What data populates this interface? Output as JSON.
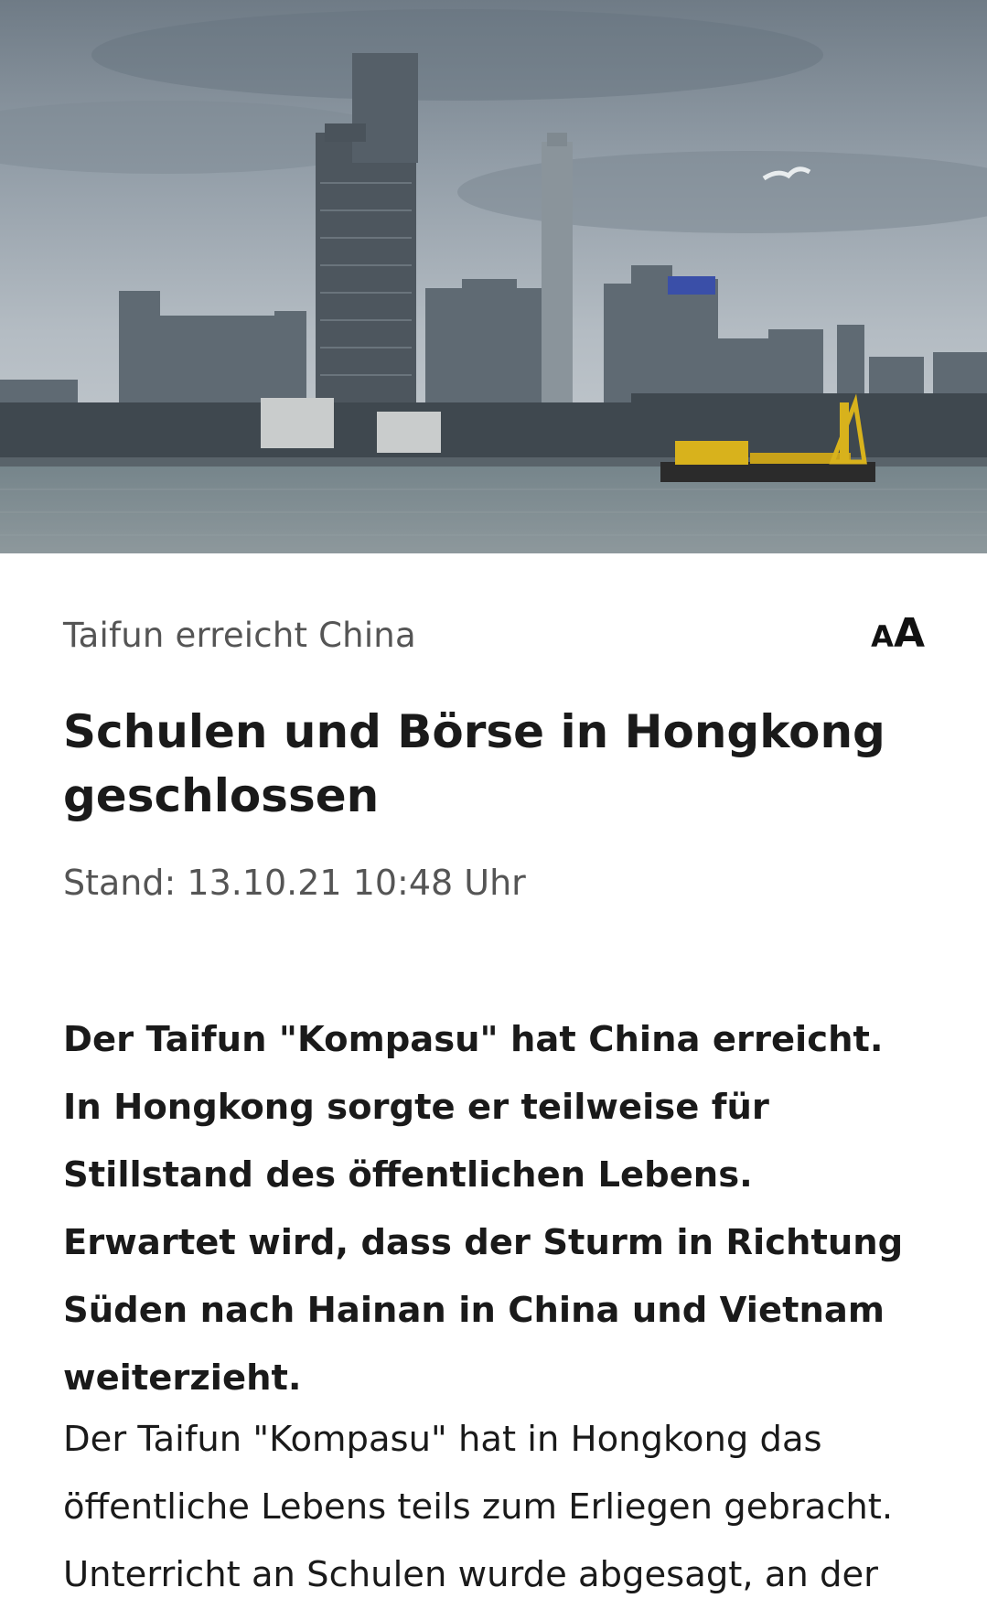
{
  "hero": {
    "image_description_icon": "hong-kong-skyline-photo"
  },
  "article": {
    "topline": "Taifun erreicht China",
    "font_size_small": "A",
    "font_size_big": "A",
    "headline": "Schulen und Börse in Hongkong geschlossen",
    "dateline": "Stand: 13.10.21 10:48 Uhr",
    "lead": "Der Taifun \"Kompasu\" hat China erreicht. In Hongkong sorgte er teilweise für Stillstand des öffentlichen Lebens. Erwartet wird, dass der Sturm in Richtung Süden nach Hainan in China und Vietnam weiterzieht.",
    "body": "Der Taifun \"Kompasu\" hat in Hongkong das öffentliche Lebens teils zum Erliegen gebracht. Unterricht an Schulen wurde abgesagt, an der"
  },
  "colors": {
    "topline": "#555555",
    "headline": "#1a1a1a",
    "water": "#6c7a80",
    "sky": "#a8b1b8"
  }
}
